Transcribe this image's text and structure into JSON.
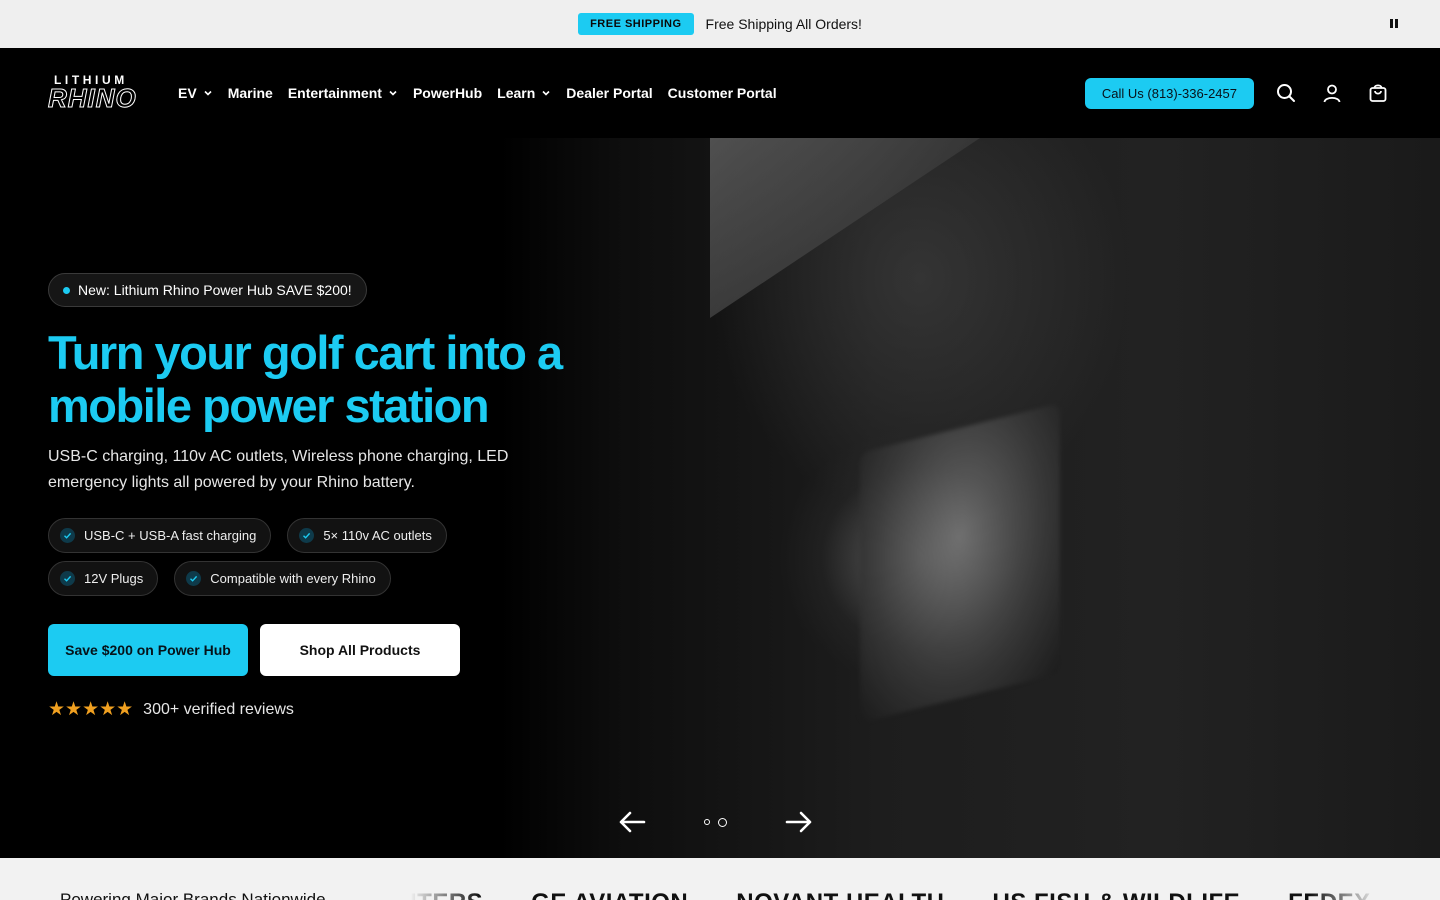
{
  "announcement": {
    "badge": "FREE SHIPPING",
    "message": "Free Shipping All Orders!",
    "pause_icon": "pause-icon"
  },
  "header": {
    "logo_top": "LITHIUM",
    "logo_bottom": "RHINO",
    "nav": [
      {
        "label": "EV",
        "dropdown": true
      },
      {
        "label": "Marine",
        "dropdown": false
      },
      {
        "label": "Entertainment",
        "dropdown": true
      },
      {
        "label": "PowerHub",
        "dropdown": false
      },
      {
        "label": "Learn",
        "dropdown": true
      },
      {
        "label": "Dealer Portal",
        "dropdown": false
      },
      {
        "label": "Customer Portal",
        "dropdown": false
      }
    ],
    "call_label": "Call Us (813)-336-2457",
    "icons": [
      "search-icon",
      "account-icon",
      "cart-icon"
    ]
  },
  "hero": {
    "pill": "New: Lithium Rhino Power Hub SAVE $200!",
    "headline": "Turn your golf cart into a mobile power station",
    "subtext": "USB-C charging, 110v AC outlets, Wireless phone charging, LED emergency lights all powered by your Rhino battery.",
    "features": [
      "USB-C + USB-A fast charging",
      "5× 110v AC outlets",
      "12V Plugs",
      "Compatible with every Rhino"
    ],
    "cta_primary": "Save $200 on Power Hub",
    "cta_secondary": "Shop All Products",
    "stars": "★★★★★",
    "rating_value": 5,
    "reviews": "300+ verified reviews",
    "slides_total": 2,
    "slide_active": 2
  },
  "brands": {
    "lead": "Powering Major Brands Nationwide",
    "names": [
      "ITERS",
      "GE AVIATION",
      "NOVANT HEALTH",
      "US FISH & WILDLIFE",
      "FEDEX CORP"
    ]
  },
  "colors": {
    "accent": "#1ccbf2",
    "star": "#f0a020",
    "header_bg": "#000000",
    "announce_bg": "#efefef"
  }
}
